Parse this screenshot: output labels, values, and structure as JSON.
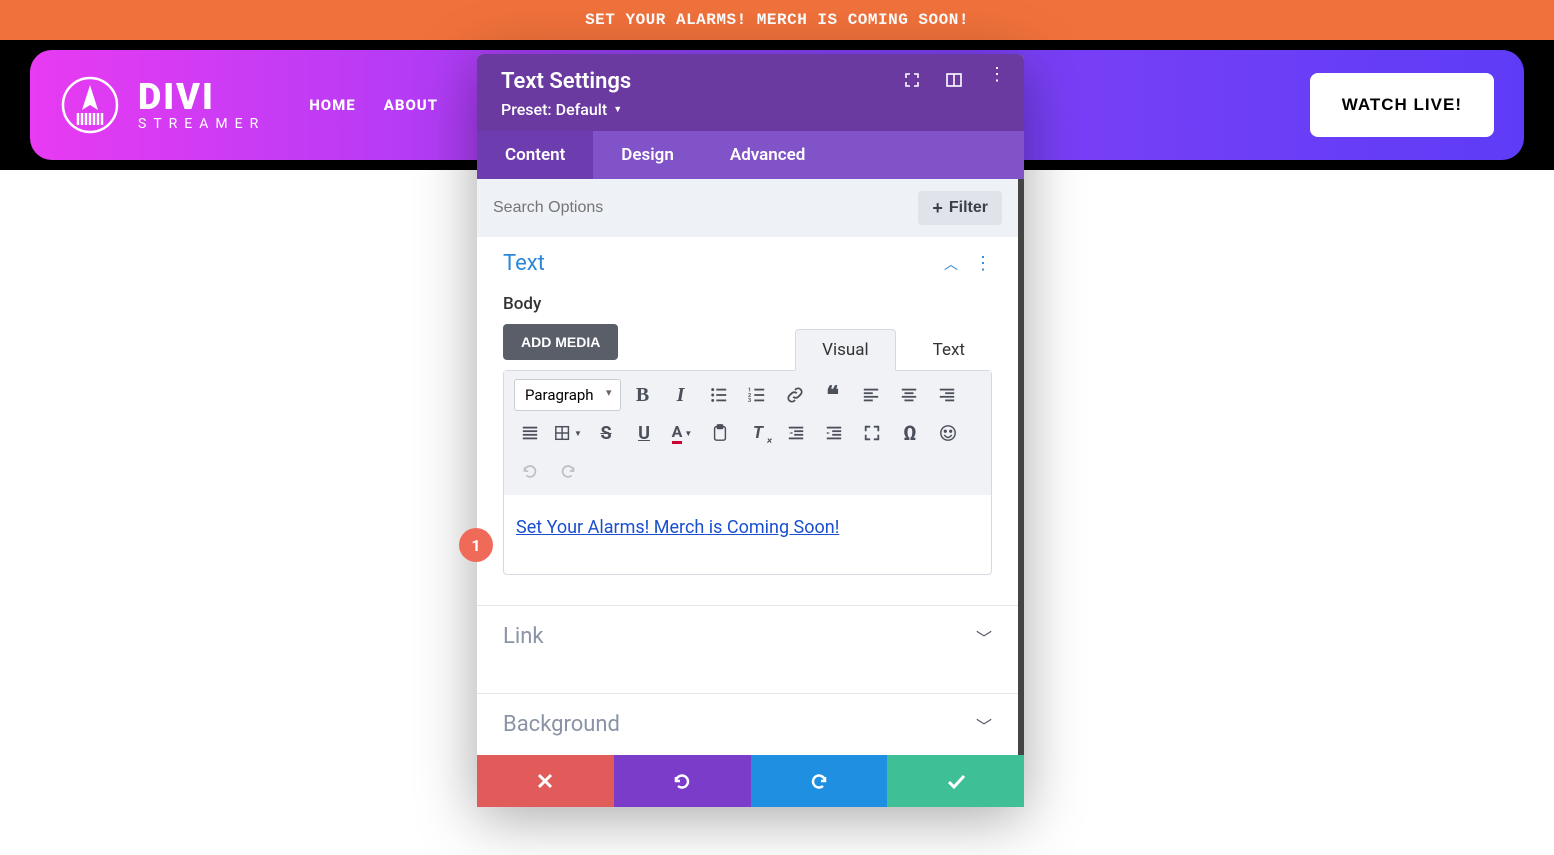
{
  "banner": {
    "text": "SET YOUR ALARMS! MERCH IS COMING SOON!"
  },
  "logo": {
    "main": "DIVI",
    "sub": "STREAMER"
  },
  "nav": {
    "home": "HOME",
    "about": "ABOUT"
  },
  "watch_button": "WATCH LIVE!",
  "modal": {
    "title": "Text Settings",
    "preset": "Preset: Default",
    "tabs": {
      "content": "Content",
      "design": "Design",
      "advanced": "Advanced"
    },
    "search_placeholder": "Search Options",
    "filter_label": "Filter",
    "sections": {
      "text": "Text",
      "link": "Link",
      "background": "Background"
    },
    "body_label": "Body",
    "add_media": "ADD MEDIA",
    "editor_tabs": {
      "visual": "Visual",
      "text": "Text"
    },
    "paragraph_select": "Paragraph",
    "editor_content": "Set Your Alarms! Merch is Coming Soon!"
  },
  "annotation": {
    "num": "1"
  }
}
